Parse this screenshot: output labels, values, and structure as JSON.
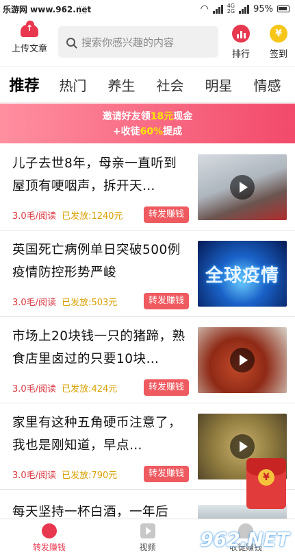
{
  "status_bar": {
    "watermark": "乐游网 www.962.net",
    "network": [
      "4G",
      "2G"
    ],
    "battery": "95%"
  },
  "header": {
    "upload_label": "上传文章",
    "search_placeholder": "搜索你感兴趣的内容",
    "rank_label": "排行",
    "sign_label": "签到",
    "sign_glyph": "¥"
  },
  "tabs": [
    {
      "label": "推荐",
      "active": true
    },
    {
      "label": "热门"
    },
    {
      "label": "养生"
    },
    {
      "label": "社会"
    },
    {
      "label": "明星"
    },
    {
      "label": "情感"
    }
  ],
  "banner": {
    "line1_pre": "邀请好友领",
    "line1_hl": "18元",
    "line1_post": "现金",
    "line2_pre": "+收徒",
    "line2_hl": "60%",
    "line2_post": "提成"
  },
  "articles": [
    {
      "title": "儿子去世8年，母亲一直听到屋顶有哽咽声，拆开天…",
      "price": "3.0毛/阅读",
      "paid": "已发放:1240元",
      "share": "转发赚钱",
      "thumb_text": ""
    },
    {
      "title": "英国死亡病例单日突破500例 疫情防控形势严峻",
      "price": "3.0毛/阅读",
      "paid": "已发放:503元",
      "share": "转发赚钱",
      "thumb_text": "全球疫情"
    },
    {
      "title": "市场上20块钱一只的猪蹄，熟食店里卤过的只要10块…",
      "price": "3.0毛/阅读",
      "paid": "已发放:424元",
      "share": "转发赚钱",
      "thumb_text": ""
    },
    {
      "title": "家里有这种五角硬币注意了，我也是刚知道，早点…",
      "price": "3.0毛/阅读",
      "paid": "已发放:790元",
      "share": "转发赚钱",
      "thumb_text": ""
    },
    {
      "title": "每天坚持一杯白酒，一年后",
      "price": "",
      "paid": "",
      "share": "",
      "thumb_text": ""
    }
  ],
  "bottom_nav": [
    {
      "label": "转发赚钱",
      "active": true
    },
    {
      "label": "视频"
    },
    {
      "label": "收徒赚钱"
    }
  ],
  "watermark_bottom": "962.NET",
  "colors": {
    "accent": "#e8384f",
    "price": "#d9363e",
    "paid": "#d8a000"
  }
}
